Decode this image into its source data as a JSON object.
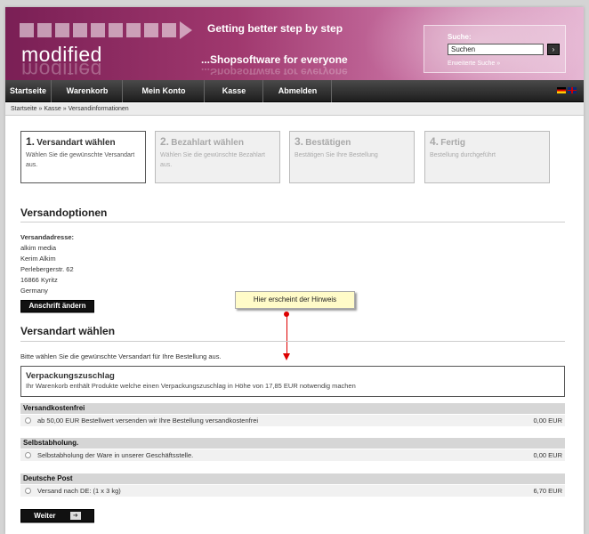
{
  "header": {
    "logo": "modified",
    "slogan_top": "Getting better step by step",
    "slogan_bottom": "...Shopsoftware for everyone",
    "search": {
      "label": "Suche:",
      "value": "Suchen",
      "button": "›",
      "advanced": "Erweiterte Suche »"
    }
  },
  "nav": {
    "items": [
      "Startseite",
      "Warenkorb",
      "Mein Konto",
      "Kasse",
      "Abmelden"
    ]
  },
  "breadcrumb": "Startseite » Kasse » Versandinformationen",
  "steps": [
    {
      "num": "1.",
      "title": "Versandart wählen",
      "desc": "Wählen Sie die gewünschte Versandart aus."
    },
    {
      "num": "2.",
      "title": "Bezahlart wählen",
      "desc": "Wählen Sie die gewünschte Bezahlart aus."
    },
    {
      "num": "3.",
      "title": "Bestätigen",
      "desc": "Bestätigen Sie Ihre Bestellung"
    },
    {
      "num": "4.",
      "title": "Fertig",
      "desc": "Bestellung durchgeführt"
    }
  ],
  "versandoptionen": {
    "heading": "Versandoptionen",
    "address_label": "Versandadresse:",
    "address_lines": [
      "alkim media",
      "Kerim Alkim",
      "Perlebergerstr. 62",
      "16866 Kyritz",
      "Germany"
    ],
    "change_button": "Anschrift ändern"
  },
  "tooltip": "Hier erscheint der Hinweis",
  "versandart": {
    "heading": "Versandart wählen",
    "intro": "Bitte wählen Sie die gewünschte Versandart für Ihre Bestellung aus.",
    "notice_title": "Verpackungszuschlag",
    "notice_text": "Ihr Warenkorb enthält Produkte welche einen Verpackungszuschlag in Höhe von 17,85 EUR notwendig machen",
    "groups": [
      {
        "title": "Versandkostenfrei",
        "option": "ab 50,00 EUR Bestellwert versenden wir Ihre Bestellung versandkostenfrei",
        "price": "0,00 EUR"
      },
      {
        "title": "Selbstabholung.",
        "option": "Selbstabholung der Ware in unserer Geschäftsstelle.",
        "price": "0,00 EUR"
      },
      {
        "title": "Deutsche Post",
        "option": "Versand nach DE: (1 x 3 kg)",
        "price": "6,70 EUR"
      }
    ],
    "continue_button": "Weiter"
  }
}
